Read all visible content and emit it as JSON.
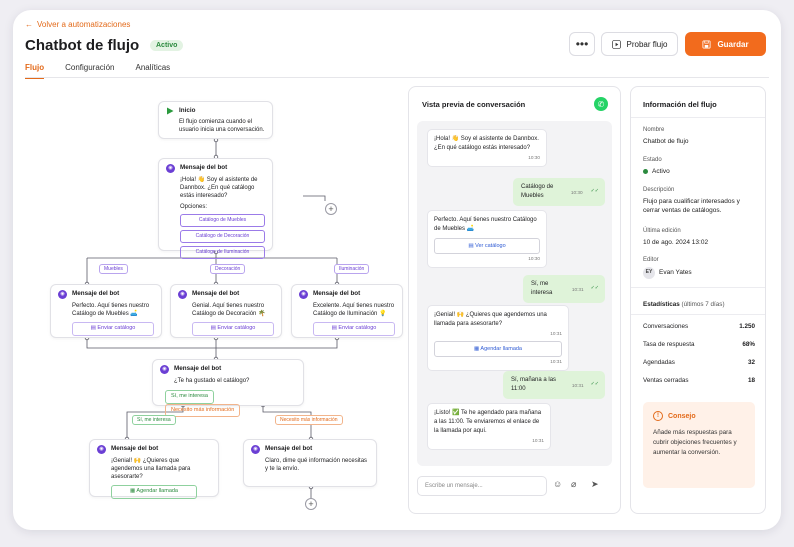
{
  "header": {
    "back_label": "Volver a automatizaciones",
    "title": "Chatbot de flujo",
    "status": "Activo",
    "more_label": "•••",
    "test_label": "Probar flujo",
    "save_label": "Guardar"
  },
  "tabs": [
    {
      "label": "Flujo",
      "active": true
    },
    {
      "label": "Configuración",
      "active": false
    },
    {
      "label": "Analíticas",
      "active": false
    }
  ],
  "flow": {
    "start": {
      "title": "Inicio",
      "text": "El flujo comienza cuando el usuario inicia una conversación."
    },
    "main": {
      "title": "Mensaje del bot",
      "text": "¡Hola! 👋 Soy el asistente de Dannbox. ¿En qué catálogo estás interesado?",
      "options_label": "Opciones:",
      "options": [
        "Catálogo de Muebles",
        "Catálogo de Decoración",
        "Catálogo de Iluminación"
      ]
    },
    "branch_labels": [
      "Muebles",
      "Decoración",
      "Iluminación"
    ],
    "branches": [
      {
        "title": "Mensaje del bot",
        "text": "Perfecto. Aquí tienes nuestro Catálogo de Muebles 🛋️",
        "button": "Enviar catálogo"
      },
      {
        "title": "Mensaje del bot",
        "text": "Genial. Aquí tienes nuestro Catálogo de Decoración 🌴",
        "button": "Enviar catálogo"
      },
      {
        "title": "Mensaje del bot",
        "text": "Excelente. Aquí tienes nuestro Catálogo de Iluminación 💡",
        "button": "Enviar catálogo"
      }
    ],
    "question": {
      "title": "Mensaje del bot",
      "text": "¿Te ha gustado el catálogo?",
      "choice_yes": "Sí, me interesa",
      "choice_more": "Necesito más información"
    },
    "edge_yes": "Sí, me interesa",
    "edge_more": "Necesito más información",
    "final_left": {
      "title": "Mensaje del bot",
      "text": "¡Genial! 🙌 ¿Quieres que agendemos una llamada para asesorarte?",
      "button": "Agendar llamada"
    },
    "final_right": {
      "title": "Mensaje del bot",
      "text": "Claro, dime qué información necesitas y te la envío."
    }
  },
  "chat": {
    "title": "Vista previa de conversación",
    "messages": [
      {
        "dir": "in",
        "text": "¡Hola! 👋 Soy el asistente de Dannbox. ¿En qué catálogo estás interesado?",
        "time": "10:30"
      },
      {
        "dir": "out",
        "text": "Catálogo de Muebles",
        "time": "10:30"
      },
      {
        "dir": "in",
        "text": "Perfecto. Aquí tienes nuestro Catálogo de Muebles 🛋️",
        "cta": "Ver catálogo",
        "time": "10:30"
      },
      {
        "dir": "out",
        "text": "Sí, me interesa",
        "time": "10:31"
      },
      {
        "dir": "in",
        "text": "¡Genial! 🙌 ¿Quieres que agendemos una llamada para asesorarte?",
        "time": "10:31",
        "cta": "Agendar llamada",
        "cta_time": "10:31"
      },
      {
        "dir": "out",
        "text": "Sí, mañana a las 11:00",
        "time": "10:31"
      },
      {
        "dir": "in",
        "text": "¡Listo! ✅ Te he agendado para mañana a las 11:00. Te enviaremos el enlace de la llamada por aquí.",
        "time": "10:31"
      }
    ],
    "input_placeholder": "Escribe un mensaje..."
  },
  "info": {
    "title": "Información del flujo",
    "name_label": "Nombre",
    "name_value": "Chatbot de flujo",
    "state_label": "Estado",
    "state_value": "Activo",
    "desc_label": "Descripción",
    "desc_value": "Flujo para cualificar interesados y cerrar ventas de catálogos.",
    "edit_label": "Última edición",
    "edit_value": "10 de ago. 2024 13:02",
    "editor_label": "Editor",
    "editor_initials": "EY",
    "editor_name": "Evan Yates",
    "stats_title": "Estadísticas",
    "stats_period": "(últimos 7 días)",
    "stats": [
      {
        "label": "Conversaciones",
        "value": "1.250"
      },
      {
        "label": "Tasa de respuesta",
        "value": "68%"
      },
      {
        "label": "Agendadas",
        "value": "32"
      },
      {
        "label": "Ventas cerradas",
        "value": "18"
      }
    ],
    "tip_title": "Consejo",
    "tip_text": "Añade más respuestas para cubrir objeciones frecuentes y aumentar la conversión."
  },
  "colors": {
    "accent": "#f26b1d",
    "bot": "#6b3fd4",
    "success": "#2b8a3e",
    "whatsapp": "#25d366"
  }
}
